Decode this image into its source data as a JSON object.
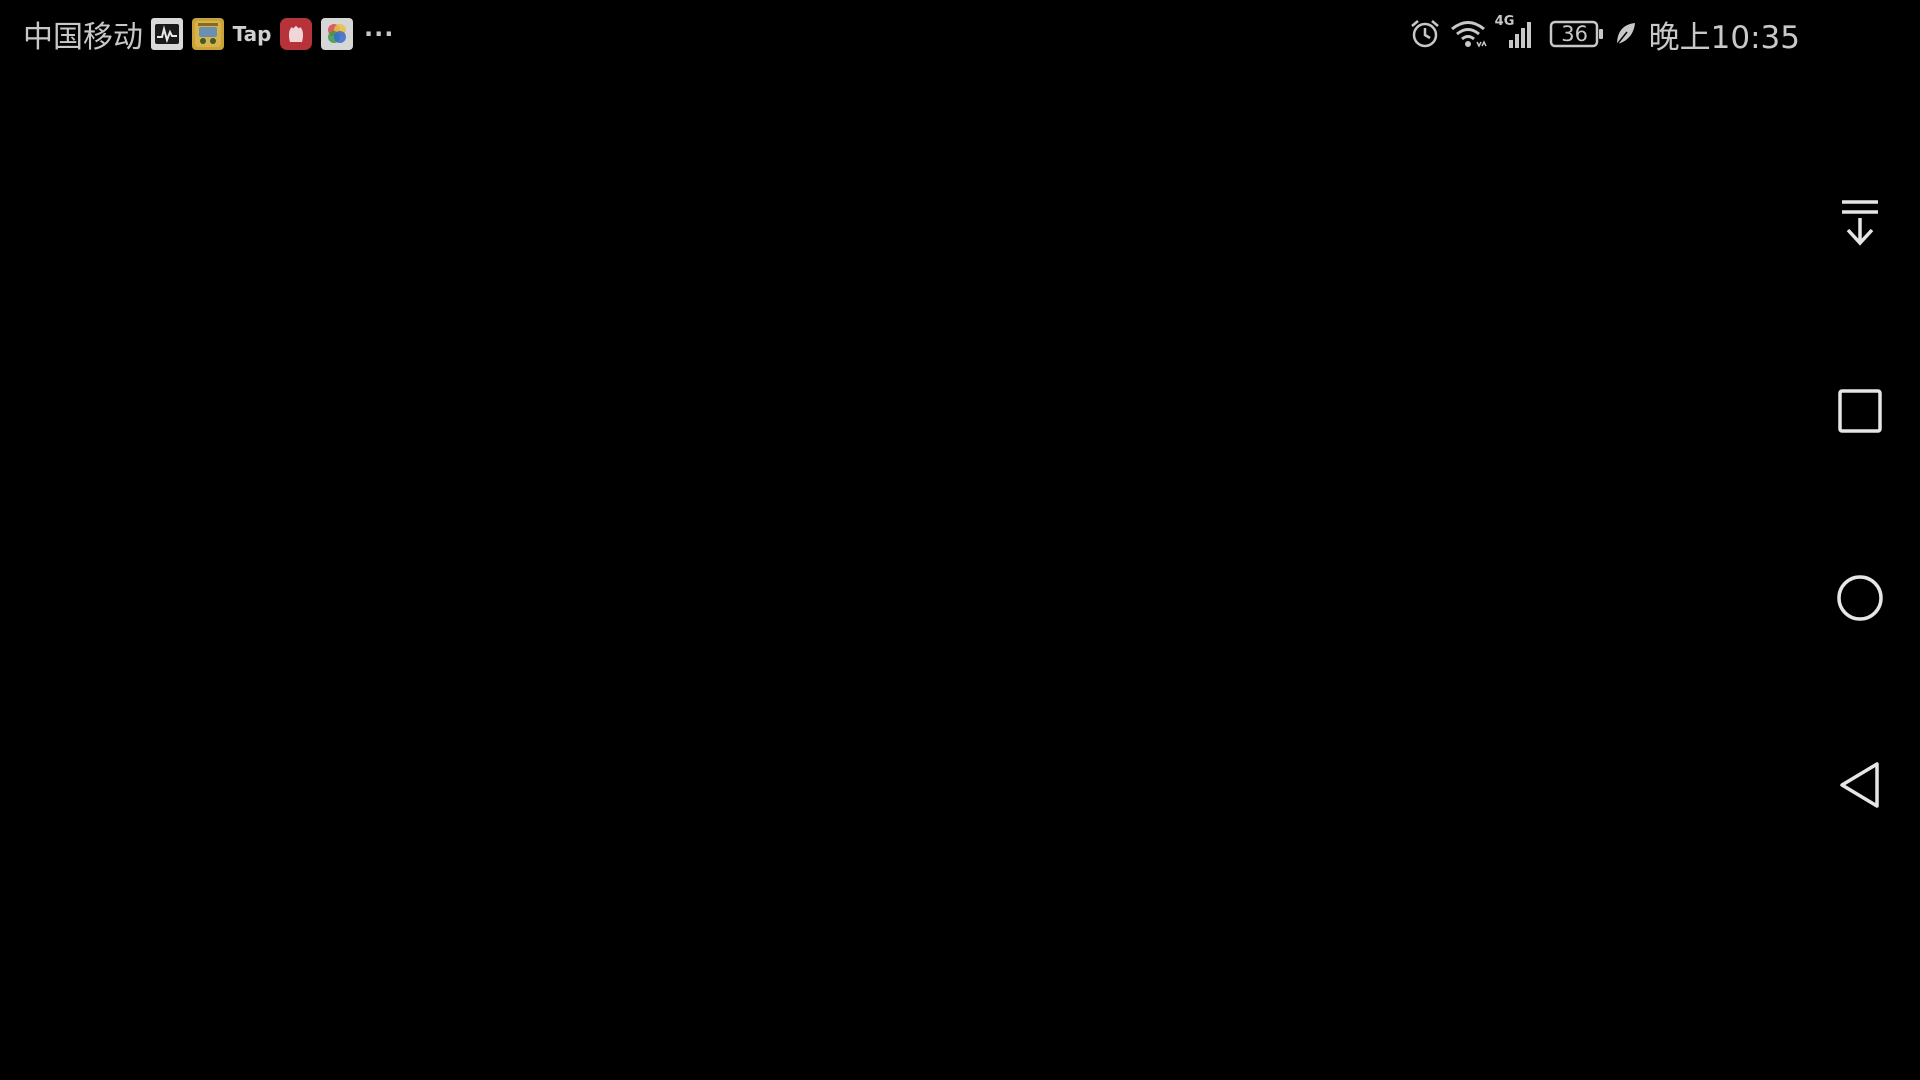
{
  "status_bar": {
    "carrier": "中国移动",
    "notification_icons": [
      {
        "name": "activity-monitor-icon"
      },
      {
        "name": "game-app-icon"
      },
      {
        "name": "tap-app-icon",
        "label": "Tap"
      },
      {
        "name": "red-app-icon"
      },
      {
        "name": "photos-app-icon"
      }
    ],
    "more_indicator": "···",
    "system_icons": [
      "alarm-icon",
      "wifi-icon",
      "4g-signal-icon",
      "battery-icon",
      "power-saving-leaf-icon"
    ],
    "network_type": "4G",
    "battery_level": "36",
    "time": "晚上10:35"
  },
  "nav_bar": {
    "buttons": [
      {
        "name": "hide-navbar-button",
        "icon": "arrow-down-with-bar-icon"
      },
      {
        "name": "recent-apps-button",
        "icon": "square-icon"
      },
      {
        "name": "home-button",
        "icon": "circle-icon"
      },
      {
        "name": "back-button",
        "icon": "triangle-left-icon"
      }
    ]
  },
  "colors": {
    "background": "#000000",
    "status_text": "#c8c8c8",
    "nav_icon": "#e6e6e6"
  }
}
